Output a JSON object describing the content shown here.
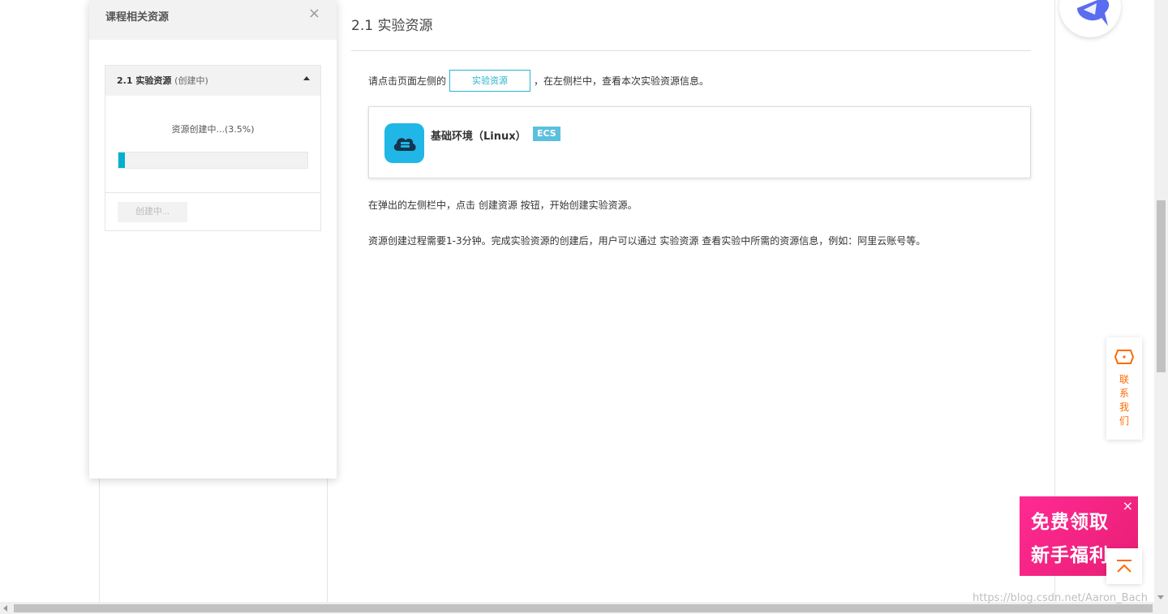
{
  "panel": {
    "title": "课程相关资源",
    "close_glyph": "×",
    "resource": {
      "title": "2.1 实验资源",
      "status": "(创建中)",
      "progress_text": "资源创建中...(3.5%)",
      "progress_fraction": 0.035,
      "create_button": "创建中..."
    }
  },
  "main": {
    "title": "2.1 实验资源",
    "line1_before": "请点击页面左侧的",
    "line1_button": "实验资源",
    "line1_after": "，在左侧栏中，查看本次实验资源信息。",
    "env": {
      "name": "基础环境（Linux）",
      "tag": "ECS",
      "icon": "cloud-server-icon"
    },
    "para1": "在弹出的左侧栏中，点击 创建资源 按钮，开始创建实验资源。",
    "para2": "资源创建过程需要1-3分钟。完成实验资源的创建后，用户可以通过 实验资源 查看实验中所需的资源信息，例如：阿里云账号等。"
  },
  "widgets": {
    "contact_label": "联系我们",
    "promo_line1": "免费领取",
    "promo_line2": "新手福利",
    "promo_close": "×"
  },
  "watermark": "https://blog.csdn.net/Aaron_Bach",
  "colors": {
    "accent": "#29b4cf",
    "progress": "#00b0d0",
    "tag": "#5bc0de",
    "contact": "#ff6a00",
    "promo": "#ff2a93"
  }
}
